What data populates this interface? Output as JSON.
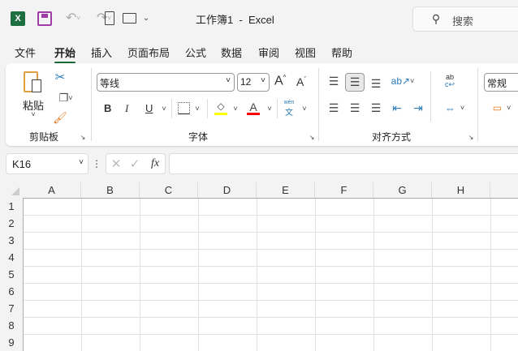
{
  "titlebar": {
    "title": "工作簿1  -  Excel",
    "search_placeholder": "搜索"
  },
  "menu": {
    "tabs": [
      {
        "label": "文件"
      },
      {
        "label": "开始",
        "active": true
      },
      {
        "label": "插入"
      },
      {
        "label": "页面布局"
      },
      {
        "label": "公式"
      },
      {
        "label": "数据"
      },
      {
        "label": "审阅"
      },
      {
        "label": "视图"
      },
      {
        "label": "帮助"
      }
    ]
  },
  "ribbon": {
    "clipboard": {
      "label": "剪贴板",
      "paste": "粘贴"
    },
    "font": {
      "label": "字体",
      "font_name": "等线",
      "font_size": "12",
      "bold": "B",
      "italic": "I",
      "underline": "U",
      "phonetic": "wén",
      "highlight_color": "#ffff00",
      "font_color": "#ff0000"
    },
    "alignment": {
      "label": "对齐方式"
    },
    "number": {
      "format": "常规"
    }
  },
  "formula_bar": {
    "name_box": "K16",
    "fx": "fx",
    "value": ""
  },
  "sheet": {
    "columns": [
      "A",
      "B",
      "C",
      "D",
      "E",
      "F",
      "G",
      "H"
    ],
    "rows": [
      "1",
      "2",
      "3",
      "4",
      "5",
      "6",
      "7",
      "8",
      "9"
    ]
  }
}
